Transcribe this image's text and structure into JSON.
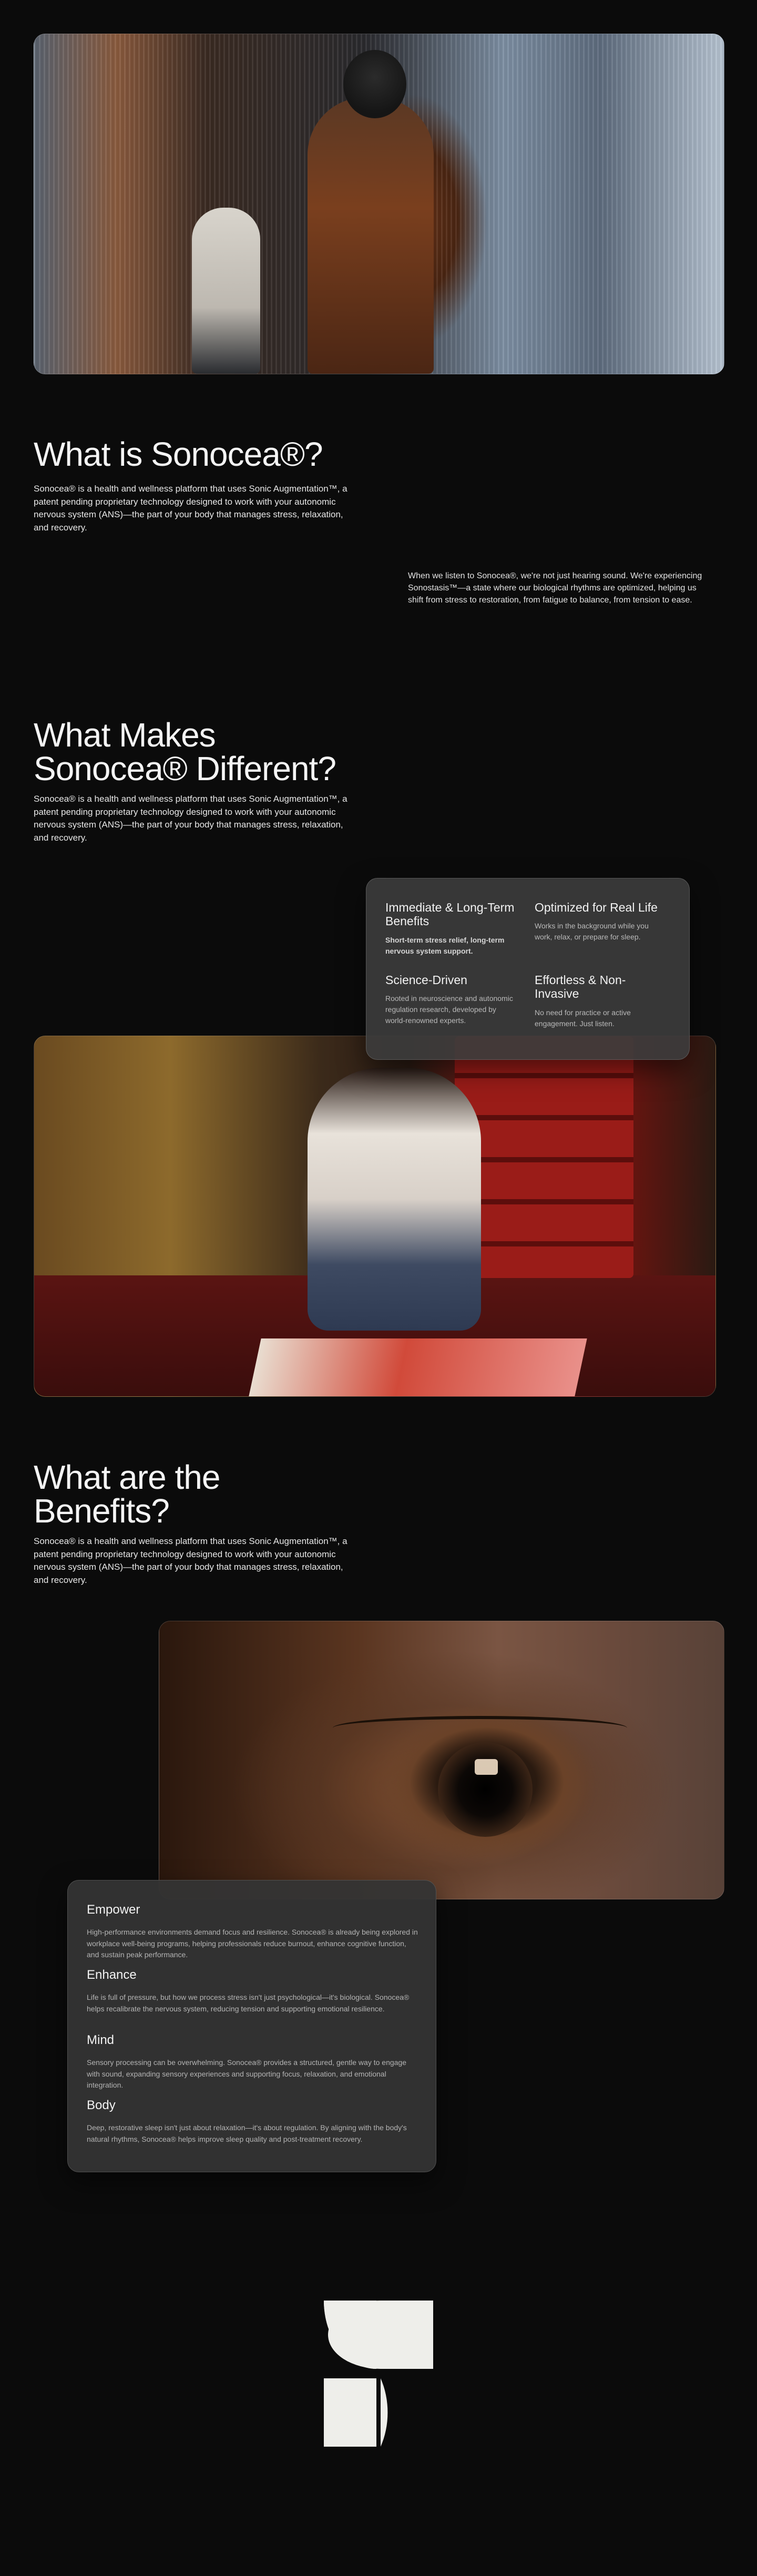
{
  "hero": {
    "image_alt": "Person with headphones walking down a city street"
  },
  "what_is": {
    "title": "What is Sonocea®?",
    "paragraph": "Sonocea® is a health and wellness platform that uses Sonic Augmentation™, a patent pending proprietary technology designed to work with your autonomic nervous system (ANS)—the part of your body that manages stress, relaxation, and recovery.",
    "side_paragraph": "When we listen to Sonocea®, we're not just hearing sound. We're experiencing Sonostasis™—a state where our biological rhythms are optimized, helping us shift from stress to restoration, from fatigue to balance, from tension to ease."
  },
  "different": {
    "title_line1": "What Makes",
    "title_line2": "Sonocea® Different?",
    "paragraph": "Sonocea® is a health and wellness platform that uses Sonic Augmentation™, a patent pending proprietary technology designed to work with your autonomic nervous system (ANS)—the part of your body that manages stress, relaxation, and recovery.",
    "features": [
      {
        "title": "Immediate & Long-Term Benefits",
        "text": "Short-term stress relief, long-term nervous system support."
      },
      {
        "title": "Optimized for Real Life",
        "text": "Works in the background while you work, relax, or prepare for sleep."
      },
      {
        "title": "Science-Driven",
        "text": "Rooted in neuroscience and autonomic regulation research, developed by world-renowned experts."
      },
      {
        "title": "Effortless & Non-Invasive",
        "text": "No need for practice or active engagement. Just listen."
      }
    ]
  },
  "painter": {
    "image_alt": "Woman kneeling on the floor painting on a large sheet"
  },
  "benefits": {
    "title_line1": "What are the",
    "title_line2": "Benefits?",
    "paragraph": "Sonocea® is a health and wellness platform that uses Sonic Augmentation™, a patent pending proprietary technology designed to work with your autonomic nervous system (ANS)—the part of your body that manages stress, relaxation, and recovery.",
    "items": [
      {
        "title": "Empower",
        "text": "High-performance environments demand focus and resilience. Sonocea® is already being explored in workplace well-being programs, helping professionals reduce burnout, enhance cognitive function, and sustain peak performance."
      },
      {
        "title": "Enhance",
        "text": "Life is full of pressure, but how we process stress isn't just psychological—it's biological. Sonocea® helps recalibrate the nervous system, reducing tension and supporting emotional resilience."
      },
      {
        "title": "Mind",
        "text": "Sensory processing can be overwhelming. Sonocea® provides a structured, gentle way to engage with sound, expanding sensory experiences and supporting focus, relaxation, and emotional integration."
      },
      {
        "title": "Body",
        "text": "Deep, restorative sleep isn't just about relaxation—it's about regulation. By aligning with the body's natural rhythms, Sonocea® helps improve sleep quality and post-treatment recovery."
      }
    ]
  },
  "eye": {
    "image_alt": "Close-up of a human eye"
  },
  "logo": {
    "name": "sonocea-logo",
    "color": "#eeeeea"
  }
}
